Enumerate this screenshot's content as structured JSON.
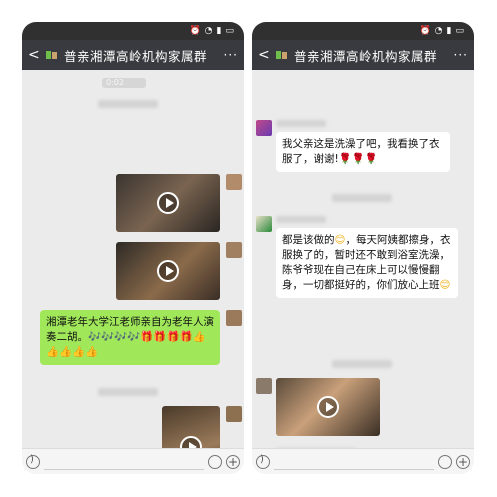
{
  "status_bar": {
    "signal": "all",
    "wifi": "wifi",
    "alarm": "alarm"
  },
  "left_phone": {
    "nav": {
      "back_label": "<",
      "title": "普亲湘潭高岭机构家属群",
      "more_label": "···"
    },
    "timestamp": "0:02",
    "message_text": "湘潭老年大学江老师亲自为老年人演奏二胡。",
    "message_emojis": "🎶🎶🎶🎶🎁🎁🎁🎁👍👍👍👍👍",
    "icons": {
      "group": "group-icon",
      "voice": "voice-icon",
      "emoji": "emoji-icon",
      "plus": "plus-icon"
    }
  },
  "right_phone": {
    "nav": {
      "back_label": "<",
      "title": "普亲湘潭高岭机构家属群",
      "more_label": "···"
    },
    "message1_text": "我父亲这是洗澡了吧，我看换了衣服了，谢谢!",
    "message1_emojis": "🌹🌹🌹",
    "message2_text_a": "都是该做的",
    "message2_smile": "😊",
    "message2_text_b": "，每天阿姨都擦身，衣服换了的，暂时还不敢到浴室洗澡，陈爷爷现在自己在床上可以慢慢翻身，一切都挺好的，你们放心上班",
    "message2_tail": "😊",
    "icons": {
      "group": "group-icon",
      "voice": "voice-icon",
      "emoji": "emoji-icon",
      "plus": "plus-icon"
    }
  },
  "colors": {
    "nav_bg": "#393a3f",
    "chat_bg": "#ebebeb",
    "green_bubble": "#a0e75a",
    "white_bubble": "#ffffff",
    "status_bg": "#303030"
  }
}
